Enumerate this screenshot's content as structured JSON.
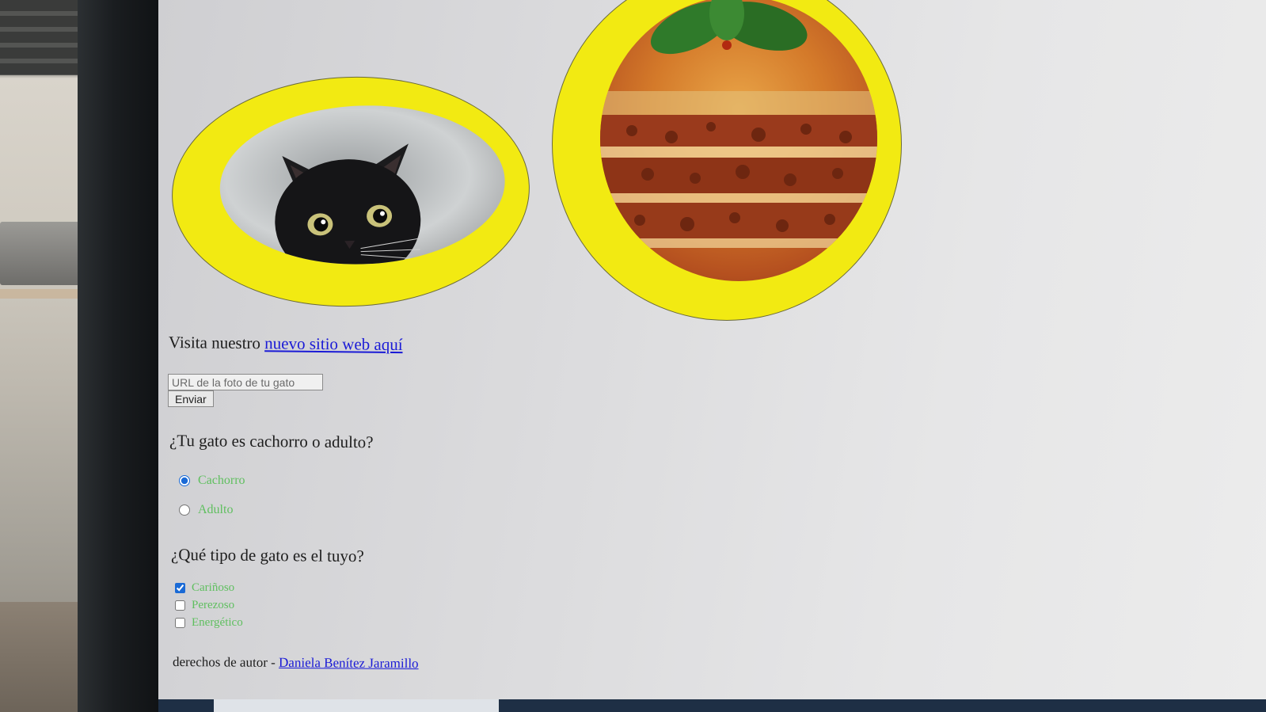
{
  "link_section": {
    "prefix": "Visita nuestro",
    "link_text": "nuevo sitio web aquí"
  },
  "form": {
    "url_placeholder": "URL de la foto de tu gato",
    "submit_label": "Enviar"
  },
  "age_question": {
    "question": "¿Tu gato es cachorro o adulto?",
    "options": [
      {
        "label": "Cachorro",
        "checked": true
      },
      {
        "label": "Adulto",
        "checked": false
      }
    ]
  },
  "type_question": {
    "question": "¿Qué tipo de gato es el tuyo?",
    "options": [
      {
        "label": "Cariñoso",
        "checked": true
      },
      {
        "label": "Perezoso",
        "checked": false
      },
      {
        "label": "Energético",
        "checked": false
      }
    ]
  },
  "footer": {
    "prefix": "derechos de autor -",
    "author": "Daniela Benítez Jaramillo"
  },
  "colors": {
    "frame_yellow": "#f2ea12",
    "link_blue": "#1a1ad6",
    "option_green": "#5fbf5f"
  },
  "images": {
    "cat": "black-cat-photo",
    "food": "lasagna-photo"
  }
}
